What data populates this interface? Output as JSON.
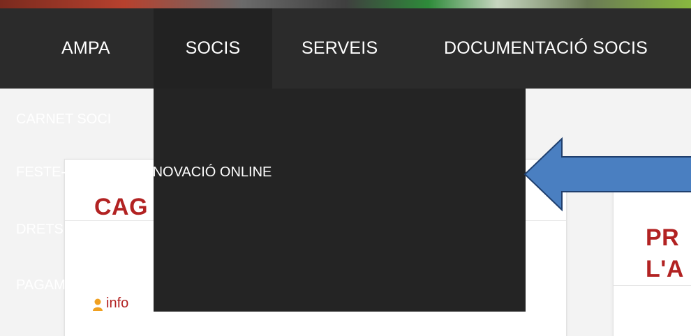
{
  "nav": {
    "items": [
      {
        "label": "AMPA"
      },
      {
        "label": "SOCIS"
      },
      {
        "label": "SERVEIS"
      },
      {
        "label": "DOCUMENTACIÓ SOCIS"
      }
    ]
  },
  "dropdown": {
    "items": [
      {
        "label": "CARNET SOCI"
      },
      {
        "label": "FESTE-TE SOCI / RENOVACIÓ ONLINE"
      },
      {
        "label": "DRETS DEL SOCI"
      },
      {
        "label": "PAGAMENTS"
      }
    ]
  },
  "content": {
    "left_card": {
      "title": "CAG",
      "author": "info"
    },
    "right_card": {
      "title_line1": "PR",
      "title_line2": "L'A"
    }
  },
  "colors": {
    "nav_background": "#2b2b2b",
    "dropdown_background": "#242424",
    "accent_red": "#b22222",
    "arrow_fill": "#4a7fc1",
    "author_icon": "#f0a020"
  },
  "icons": {
    "author": "user-icon",
    "pointer": "left-arrow-icon"
  }
}
